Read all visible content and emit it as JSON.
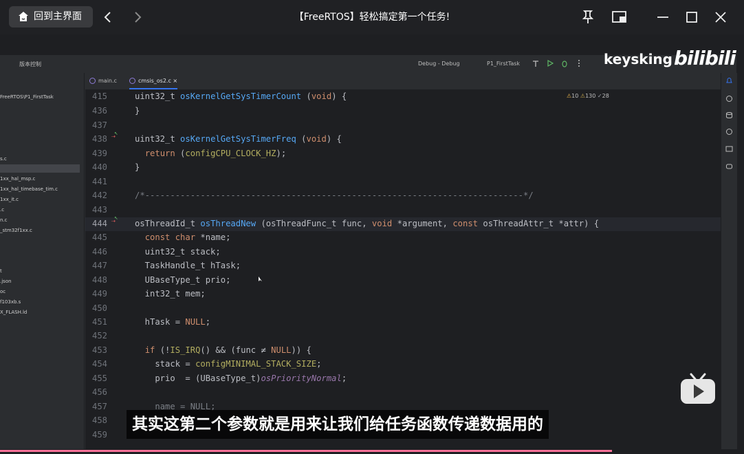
{
  "player": {
    "home_label": "回到主界面",
    "title": "【FreeRTOS】轻松搞定第一个任务!",
    "back_icon": "chevron-left-icon",
    "forward_icon": "chevron-right-icon",
    "pin_icon": "pin-icon",
    "pip_icon": "picture-in-picture-icon",
    "minimize_icon": "minimize-icon",
    "maximize_icon": "maximize-icon",
    "close_icon": "close-icon"
  },
  "ide": {
    "vcs_label": "版本控制",
    "run_config": "Debug - Debug",
    "run_target": "P1_FirstTask",
    "tabs": [
      {
        "label": "main.c",
        "active": false
      },
      {
        "label": "cmsis_os2.c",
        "active": true
      }
    ],
    "project_path": "FreeRTOS\\P1_FirstTask",
    "project_files": [
      "s.c",
      "",
      "1xx_hal_msp.c",
      "1xx_hal_timebase_tim.c",
      "1xx_it.c",
      ".c",
      "n.c",
      "_stm32f1xx.c",
      "",
      "t",
      ".json",
      "oc",
      "f103xb.s",
      "X_FLASH.ld"
    ],
    "inspections": {
      "warnings": "10",
      "weak_warnings": "130",
      "typos": "28"
    },
    "code_lines": [
      {
        "num": "415",
        "html": "uint32_t <span class='f'>osKernelGetSysTimerCount</span> (<span class='k'>void</span>) {"
      },
      {
        "num": "436",
        "html": "}"
      },
      {
        "num": "437",
        "html": ""
      },
      {
        "num": "438",
        "html": "uint32_t <span class='f'>osKernelGetSysTimerFreq</span> (<span class='k'>void</span>) {",
        "marker": true
      },
      {
        "num": "439",
        "html": "  <span class='k'>return</span> (<span class='m'>configCPU_CLOCK_HZ</span>);"
      },
      {
        "num": "440",
        "html": "}"
      },
      {
        "num": "441",
        "html": ""
      },
      {
        "num": "442",
        "html": "<span class='c'>/*---------------------------------------------------------------------------*/</span>"
      },
      {
        "num": "443",
        "html": ""
      },
      {
        "num": "444",
        "html": "osThreadId_t <span class='f'>osThreadNew</span> (osThreadFunc_t <span class='t'>func</span>, <span class='k'>void</span> *argument, <span class='k'>const</span> osThreadAttr_t *attr) {",
        "marker": true,
        "current": true
      },
      {
        "num": "445",
        "html": "  <span class='k'>const char</span> *name;"
      },
      {
        "num": "446",
        "html": "  uint32_t stack;"
      },
      {
        "num": "447",
        "html": "  TaskHandle_t hTask;"
      },
      {
        "num": "448",
        "html": "  UBaseType_t prio;"
      },
      {
        "num": "449",
        "html": "  int32_t mem;"
      },
      {
        "num": "450",
        "html": ""
      },
      {
        "num": "451",
        "html": "  hTask = <span class='k'>NULL</span>;"
      },
      {
        "num": "452",
        "html": ""
      },
      {
        "num": "453",
        "html": "  <span class='k'>if</span> (!<span class='m'>IS_IRQ</span>() &amp;&amp; (func ≠ <span class='k'>NULL</span>)) {"
      },
      {
        "num": "454",
        "html": "    stack = <span class='m'>configMINIMAL_STACK_SIZE</span>;"
      },
      {
        "num": "455",
        "html": "    prio  = (UBaseType_t)<span class='mi'>osPriorityNormal</span>;"
      },
      {
        "num": "456",
        "html": ""
      },
      {
        "num": "457",
        "html": "    <span class='c'>name = NULL;</span>"
      },
      {
        "num": "458",
        "html": ""
      },
      {
        "num": "459",
        "html": ""
      }
    ]
  },
  "overlay": {
    "brand_text": "keysking",
    "brand_logo": "bilibili",
    "subtitle": "其实这第二个参数就是用来让我们给任务函数传递数据用的",
    "play_icon": "bilibili-tv-play-icon"
  },
  "colors": {
    "progress": "#fb7299",
    "accent": "#3574f0"
  }
}
